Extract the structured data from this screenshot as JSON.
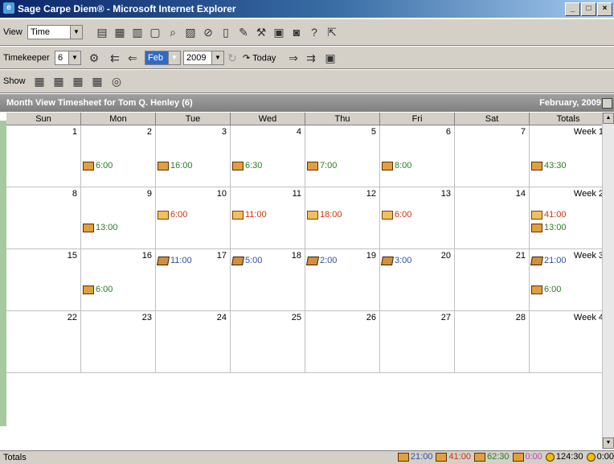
{
  "window": {
    "title": "Sage Carpe Diem® - Microsoft Internet Explorer",
    "min": "_",
    "max": "□",
    "close": "×"
  },
  "toolbar1": {
    "view_label": "View",
    "view_value": "Time",
    "icons": [
      "print-icon",
      "calendar-month-icon",
      "calendar-week-icon",
      "calendar-day-icon",
      "search-icon",
      "book-icon",
      "attach-icon",
      "document-icon",
      "edit-icon",
      "tools-icon",
      "timesheet-icon",
      "camera-icon",
      "help-icon",
      "exit-icon"
    ]
  },
  "toolbar2": {
    "timekeeper_label": "Timekeeper",
    "timekeeper_value": "6",
    "month_value": "Feb",
    "year_value": "2009",
    "today_label": "Today"
  },
  "toolbar3": {
    "show_label": "Show"
  },
  "header": {
    "title": "Month View Timesheet for Tom Q. Henley (6)",
    "date": "February, 2009"
  },
  "days": [
    "Sun",
    "Mon",
    "Tue",
    "Wed",
    "Thu",
    "Fri",
    "Sat",
    "Totals"
  ],
  "weeks": [
    {
      "label": "Week 1",
      "nums": [
        "1",
        "2",
        "3",
        "4",
        "5",
        "6",
        "7"
      ],
      "entries": [
        [],
        [
          {
            "t": "6:00",
            "c": "green",
            "r": 1
          }
        ],
        [
          {
            "t": "16:00",
            "c": "green",
            "r": 1
          }
        ],
        [
          {
            "t": "6:30",
            "c": "green",
            "r": 1
          }
        ],
        [
          {
            "t": "7:00",
            "c": "green",
            "r": 1
          }
        ],
        [
          {
            "t": "8:00",
            "c": "green",
            "r": 1
          }
        ],
        [],
        [
          {
            "t": "43:30",
            "c": "green",
            "r": 1
          }
        ]
      ]
    },
    {
      "label": "Week 2",
      "nums": [
        "8",
        "9",
        "10",
        "11",
        "12",
        "13",
        "14"
      ],
      "entries": [
        [],
        [
          {
            "t": "13:00",
            "c": "green",
            "r": 1
          }
        ],
        [
          {
            "t": "6:00",
            "c": "red",
            "r": 0
          }
        ],
        [
          {
            "t": "11:00",
            "c": "red",
            "r": 0
          }
        ],
        [
          {
            "t": "18:00",
            "c": "red",
            "r": 0
          }
        ],
        [
          {
            "t": "6:00",
            "c": "red",
            "r": 0
          }
        ],
        [],
        [
          {
            "t": "41:00",
            "c": "red",
            "r": 0
          },
          {
            "t": "13:00",
            "c": "green",
            "r": 1
          }
        ]
      ]
    },
    {
      "label": "Week 3",
      "nums": [
        "15",
        "16",
        "17",
        "18",
        "19",
        "20",
        "21"
      ],
      "entries": [
        [],
        [
          {
            "t": "6:00",
            "c": "green",
            "r": 1
          }
        ],
        [
          {
            "t": "11:00",
            "c": "blue",
            "r": 0
          }
        ],
        [
          {
            "t": "5:00",
            "c": "blue",
            "r": 0
          }
        ],
        [
          {
            "t": "2:00",
            "c": "blue",
            "r": 0
          }
        ],
        [
          {
            "t": "3:00",
            "c": "blue",
            "r": 0
          }
        ],
        [],
        [
          {
            "t": "21:00",
            "c": "blue",
            "r": 0
          },
          {
            "t": "6:00",
            "c": "green",
            "r": 1
          }
        ]
      ]
    },
    {
      "label": "Week 4",
      "nums": [
        "22",
        "23",
        "24",
        "25",
        "26",
        "27",
        "28"
      ],
      "entries": [
        [],
        [],
        [],
        [],
        [],
        [],
        [],
        []
      ]
    }
  ],
  "status": {
    "label": "Totals",
    "totals": [
      {
        "t": "21:00",
        "c": "#3050a8"
      },
      {
        "t": "41:00",
        "c": "#d03010"
      },
      {
        "t": "62:30",
        "c": "#2a7a2a"
      },
      {
        "t": "0:00",
        "c": "#c040c0"
      },
      {
        "t": "124:30",
        "c": "#000000"
      },
      {
        "t": "0:00",
        "c": "#000000"
      }
    ]
  }
}
